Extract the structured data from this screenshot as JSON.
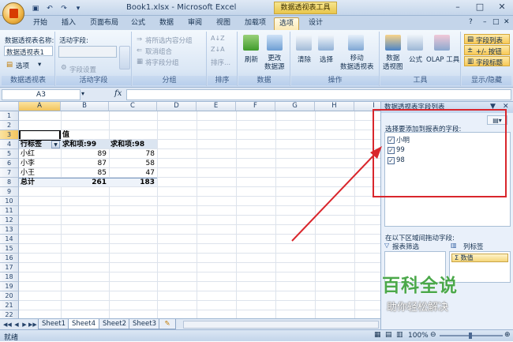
{
  "window": {
    "title": "Book1.xlsx - Microsoft Excel",
    "context_tool": "数据透视表工具"
  },
  "ribbon_tabs": [
    "开始",
    "插入",
    "页面布局",
    "公式",
    "数据",
    "审阅",
    "视图",
    "加载项",
    "选项",
    "设计"
  ],
  "active_tab": "选项",
  "ribbon": {
    "pivot_group": {
      "name_label": "数据透视表名称:",
      "name_value": "数据透视表1",
      "options_label": "选项",
      "title": "数据透视表"
    },
    "active_field_group": {
      "label": "活动字段:",
      "settings": "字段设置",
      "title": "活动字段"
    },
    "group_group": {
      "items": [
        "将所选内容分组",
        "取消组合",
        "将字段分组"
      ],
      "title": "分组"
    },
    "sort_group": {
      "sort_label": "排序...",
      "title": "排序"
    },
    "data_group": {
      "refresh": "刷新",
      "change_source": "更改\n数据源",
      "title": "数据"
    },
    "actions_group": {
      "clear": "清除",
      "select": "选择",
      "move": "移动\n数据透视表",
      "title": "操作"
    },
    "tools_group": {
      "pivotchart": "数据\n透视图",
      "formula": "公式",
      "olap": "OLAP 工具",
      "title": "工具"
    },
    "show_group": {
      "field_list": "字段列表",
      "buttons": "+/- 按钮",
      "headers": "字段标题",
      "title": "显示/隐藏"
    }
  },
  "formula_bar": {
    "name_box": "A3",
    "fx": "fx",
    "value": ""
  },
  "columns": [
    "A",
    "B",
    "C",
    "D",
    "E",
    "F",
    "G",
    "H",
    "I"
  ],
  "rows": [
    "1",
    "2",
    "3",
    "4",
    "5",
    "6",
    "7",
    "8",
    "9",
    "10",
    "11",
    "12",
    "13",
    "14",
    "15",
    "16",
    "17",
    "18",
    "19",
    "20",
    "21",
    "22"
  ],
  "pivot": {
    "header_value": "值",
    "row_label": "行标签",
    "col1": "求和项:99",
    "col2": "求和项:98",
    "data": [
      {
        "name": "小红",
        "v1": "89",
        "v2": "78"
      },
      {
        "name": "小李",
        "v1": "87",
        "v2": "58"
      },
      {
        "name": "小王",
        "v1": "85",
        "v2": "47"
      }
    ],
    "total_label": "总计",
    "total1": "261",
    "total2": "183"
  },
  "sheets": [
    "Sheet1",
    "Sheet4",
    "Sheet2",
    "Sheet3"
  ],
  "active_sheet": "Sheet4",
  "status": {
    "ready": "就绪",
    "zoom": "100%"
  },
  "field_pane": {
    "title": "数据透视表字段列表",
    "choose_label": "选择要添加到报表的字段:",
    "fields": [
      {
        "name": "小明",
        "checked": true
      },
      {
        "name": "99",
        "checked": true
      },
      {
        "name": "98",
        "checked": true
      }
    ],
    "drag_label": "在以下区域间拖动字段:",
    "report_filter": "报表筛选",
    "column_labels": "列标签",
    "value_field": "Σ 数值"
  },
  "watermark": {
    "logo": "百科全说",
    "tagline": "助你轻松解决"
  },
  "colors": {
    "annotation": "#d9262c",
    "watermark": "#4ba84a",
    "ribbon_bg": "#dbe7f5"
  }
}
